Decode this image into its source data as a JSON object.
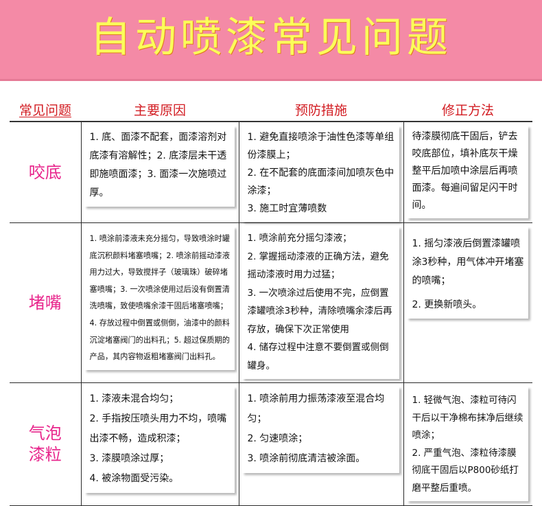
{
  "banner": {
    "title": "自动喷漆常见问题",
    "background": "#f48aa6",
    "title_color": "#fbff5a"
  },
  "table": {
    "headers": {
      "problem": "常见问题",
      "cause": "主要原因",
      "prevention": "预防措施",
      "fix": "修正方法"
    },
    "header_color": "#d21c22",
    "problem_color": "#e8268c",
    "rows": [
      {
        "problem": "咬底",
        "cause": [
          "1. 底、面漆不配套，面漆溶剂对底漆有溶解性；2. 底漆层未干透即施喷面漆；3. 面漆一次施喷过厚。"
        ],
        "prevention": [
          "1. 避免直接喷涂于油性色漆等单组份漆膜上；",
          "2. 在不配套的底面漆间加喷灰色中涂漆；",
          "3. 施工时宜薄喷数"
        ],
        "fix": [
          "待漆膜彻底干固后，铲去咬底部位，填补底灰干燥整平后加喷中涂层后再喷面漆。每遍间留足闪干时间。"
        ]
      },
      {
        "problem": "堵嘴",
        "cause": [
          "1. 喷涂前漆液未充分摇匀，导致喷涂时罐底沉积颜料堵塞喷嘴；2. 喷涂前摇动漆液用力过大，导致搅拌子（玻璃珠）破碎堵塞喷嘴；3. 一次喷涂使用过后没有倒置清洗喷嘴，致使喷嘴余漆干固后堵塞喷嘴；4. 存放过程中倒置或侧倒，油漆中的颜料沉淀堵塞阀门的出料孔；5. 超过保质期的产品，其内容物返粗堵塞阀门出料孔。"
        ],
        "prevention": [
          "1. 喷涂前充分摇匀漆液；",
          "2. 掌握摇动漆液的正确方法，避免摇动漆液时用力过猛；",
          "3. 一次喷涂过后使用不完，应倒置漆罐喷涂3秒种，清除喷嘴余漆后再存放，确保下次正常使用",
          "4. 储存过程中注意不要倒置或侧倒罐身。"
        ],
        "fix": [
          "1.  摇匀漆液后倒置漆罐喷涂3秒种，用气体冲开堵塞的喷嘴；",
          "2. 更换新喷头。"
        ]
      },
      {
        "problem": "气泡漆粒",
        "cause": [
          "1. 漆液未混合均匀；",
          "2. 手指按压喷头用力不均，喷嘴出漆不畅，造成积漆；",
          "3. 漆膜喷涂过厚；",
          "4. 被涂物面受污染。"
        ],
        "prevention": [
          "1. 喷涂前用力振荡漆液至混合均匀；",
          "2. 匀速喷涂；",
          "3. 喷涂前彻底清洁被涂面。"
        ],
        "fix": [
          "1. 轻微气泡、漆粒可待闪干后以干净棉布抹净后继续喷涂；",
          "2. 严重气泡、漆粒待漆膜彻底干固后以P800砂纸打磨平整后重喷。"
        ]
      }
    ]
  }
}
